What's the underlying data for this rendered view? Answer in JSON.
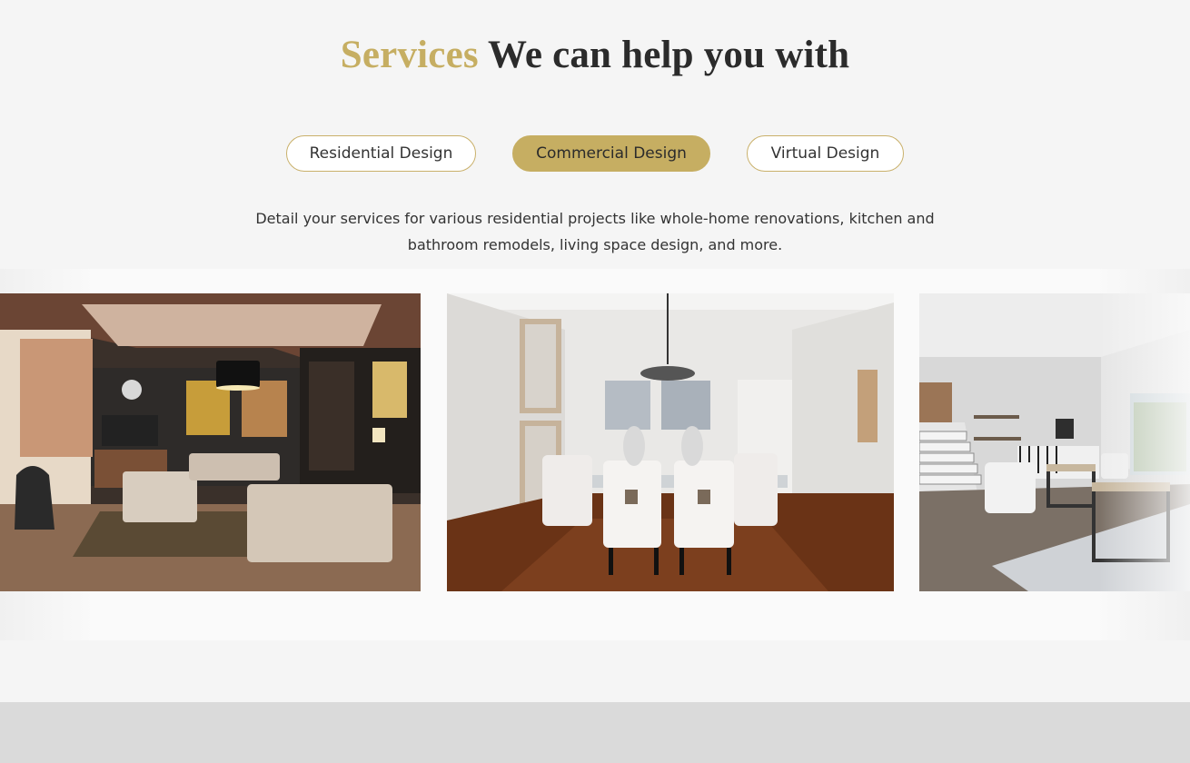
{
  "heading": {
    "accent": "Services",
    "rest": "We can help you with"
  },
  "tabs": [
    {
      "label": "Residential Design",
      "active": false
    },
    {
      "label": "Commercial Design",
      "active": true
    },
    {
      "label": "Virtual Design",
      "active": false
    }
  ],
  "description": "Detail your services for various residential projects like whole-home renovations, kitchen and bathroom remodels, living space design, and more.",
  "colors": {
    "accent": "#c6ae62",
    "text": "#2b2b2b",
    "background": "#f5f5f5",
    "footer": "#dadada"
  },
  "gallery": [
    {
      "image": "living-room-photo"
    },
    {
      "image": "dining-room-photo"
    },
    {
      "image": "open-living-staircase-photo"
    }
  ]
}
